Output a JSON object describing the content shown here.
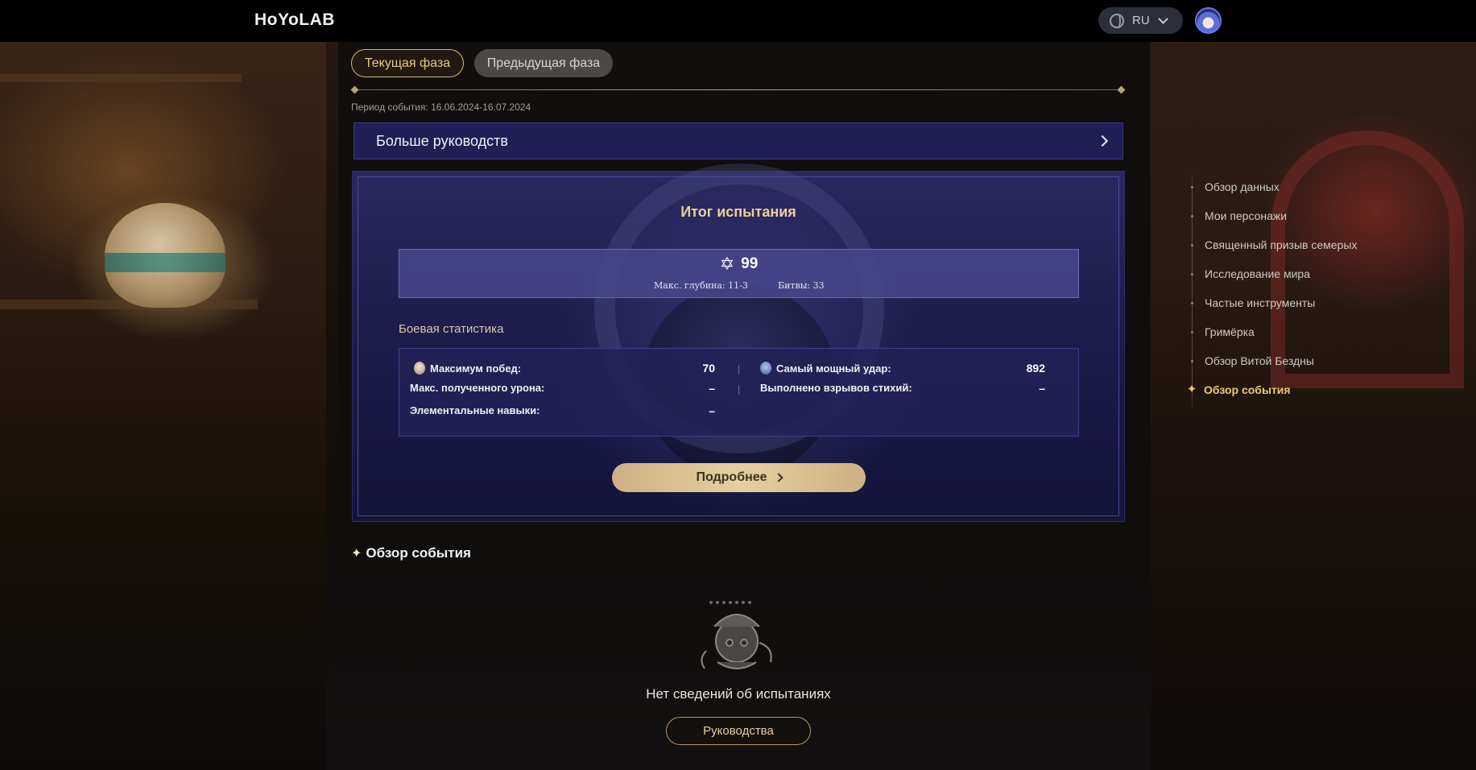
{
  "header": {
    "logo": "HoYoLAB",
    "language": "RU",
    "icons": {
      "language": "globe-icon",
      "dropdown": "chevron-down-icon",
      "avatar": "user-avatar"
    }
  },
  "phase_tabs": {
    "current": "Текущая фаза",
    "previous": "Предыдущая фаза"
  },
  "period": "Период события: 16.06.2024-16.07.2024",
  "guides_bar": {
    "label": "Больше руководств"
  },
  "summary": {
    "title": "Итог испытания",
    "stars": "99",
    "max_depth": "Макс. глубина: 11-3",
    "battles": "Битвы: 33",
    "stats_label": "Боевая статистика",
    "stats": {
      "max_wins_label": "Максимум побед:",
      "max_wins_value": "70",
      "strongest_hit_label": "Самый мощный удар:",
      "strongest_hit_value": "892",
      "max_damage_taken_label": "Макс. полученного урона:",
      "max_damage_taken_value": "–",
      "bursts_label": "Выполнено взрывов стихий:",
      "bursts_value": "–",
      "elemental_skills_label": "Элементальные навыки:",
      "elemental_skills_value": "–"
    },
    "details_button": "Подробнее"
  },
  "event_overview": {
    "title": "Обзор события",
    "empty_text": "Нет сведений об испытаниях",
    "guides_button": "Руководства"
  },
  "side_nav": {
    "items": [
      {
        "label": "Обзор данных",
        "active": false
      },
      {
        "label": "Мои персонажи",
        "active": false
      },
      {
        "label": "Священный призыв семерых",
        "active": false
      },
      {
        "label": "Исследование мира",
        "active": false
      },
      {
        "label": "Частые инструменты",
        "active": false
      },
      {
        "label": "Гримёрка",
        "active": false
      },
      {
        "label": "Обзор Витой Бездны",
        "active": false
      },
      {
        "label": "Обзор события",
        "active": true
      }
    ]
  },
  "colors": {
    "accent_gold": "#e6cf9f",
    "card_purple": "#201f55",
    "active_nav": "#ecc877"
  }
}
